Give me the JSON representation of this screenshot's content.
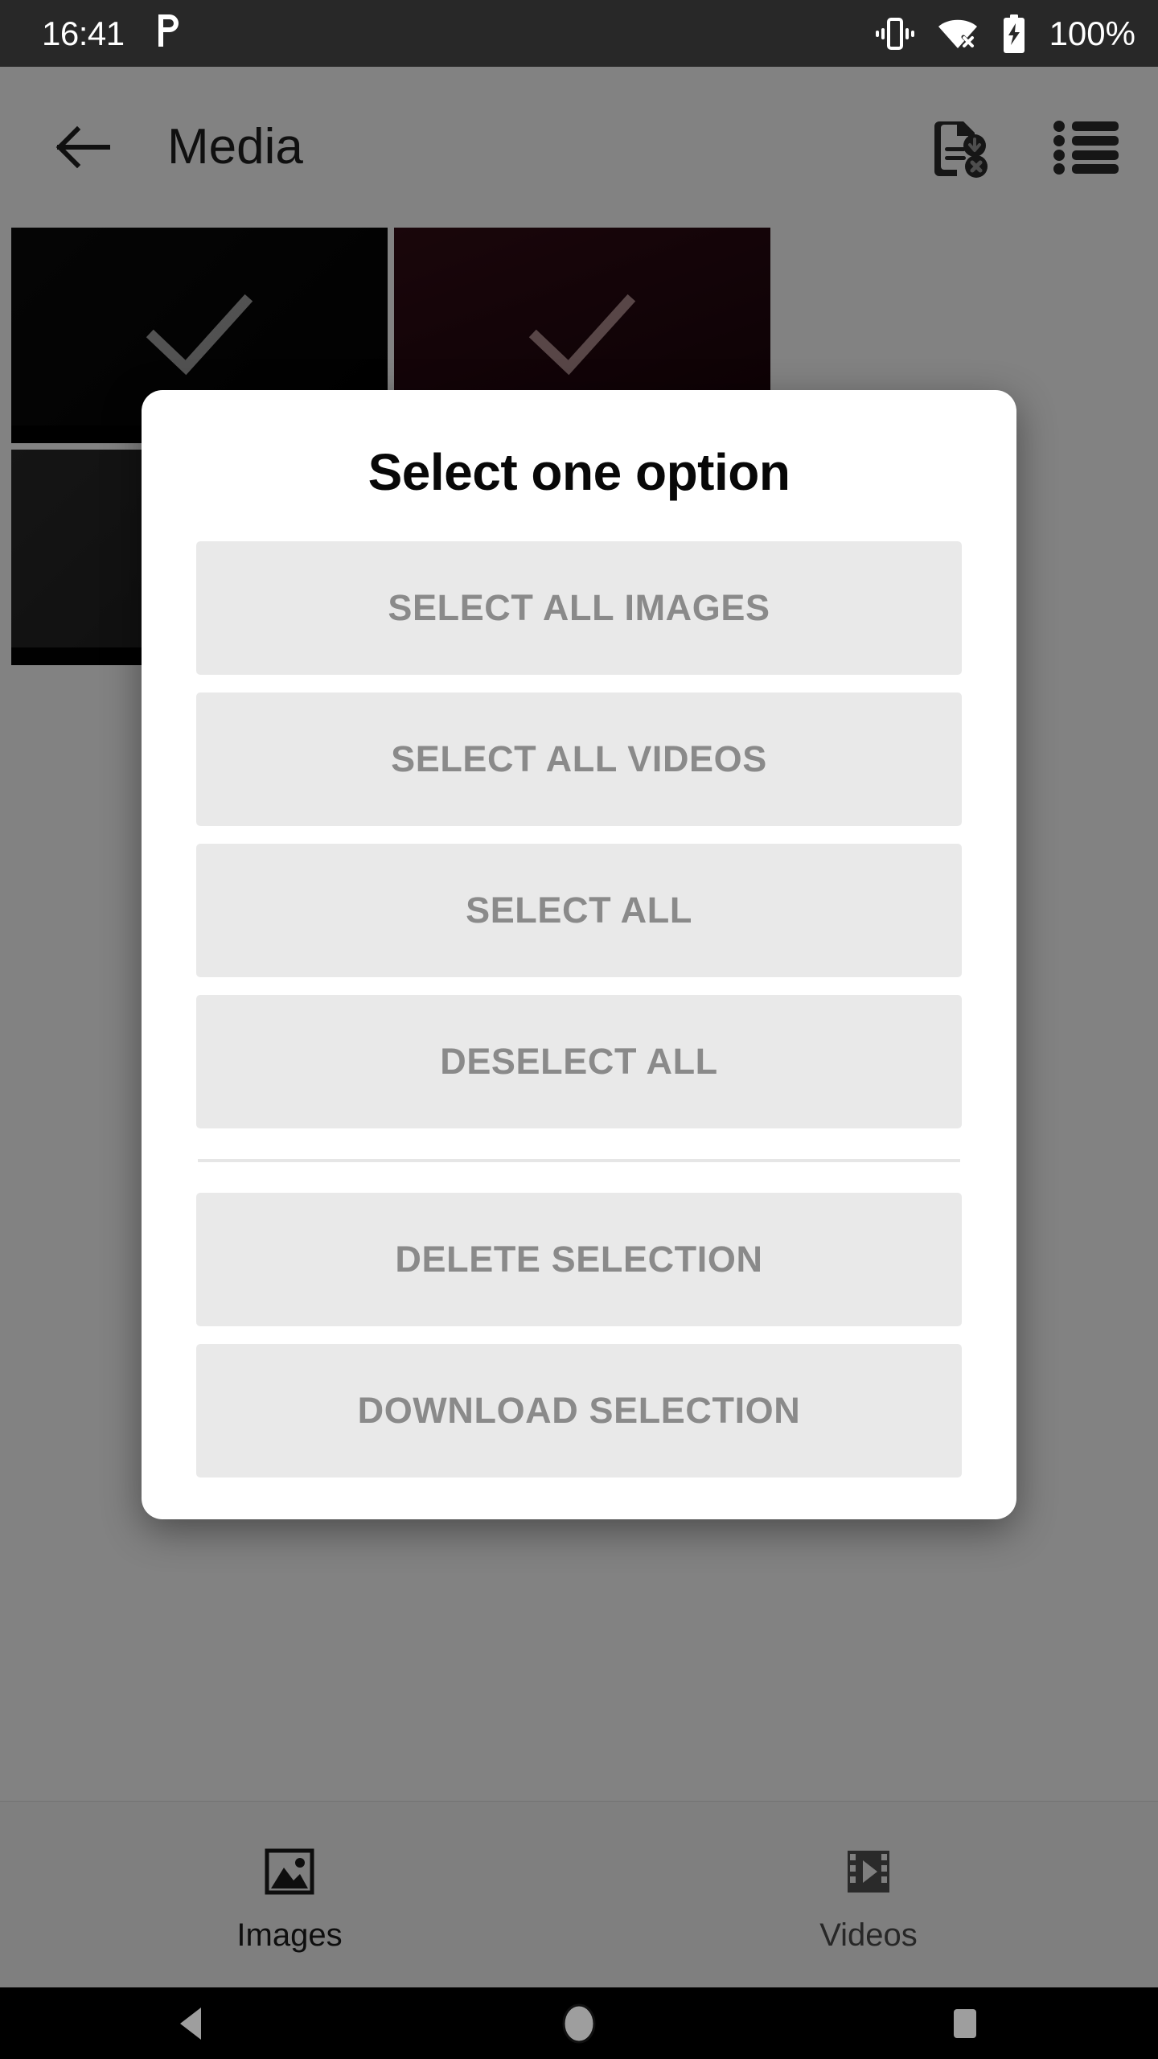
{
  "status_bar": {
    "time": "16:41",
    "notification_icon": "p-notification-icon",
    "notification_glyph": "ᴘ",
    "icons": [
      "vibrate-icon",
      "wifi-off-icon",
      "battery-charging-icon"
    ],
    "battery_percent": "100%",
    "background_color": "#282828",
    "foreground_color": "#ffffff"
  },
  "app_bar": {
    "back_icon": "back-arrow-icon",
    "title": "Media",
    "actions": [
      {
        "name": "file-download-remove-icon"
      },
      {
        "name": "list-view-icon"
      }
    ]
  },
  "media_grid": {
    "thumbnails": [
      {
        "name": "media-thumbnail-1",
        "selected": true,
        "color": "#070707",
        "check": "check-icon"
      },
      {
        "name": "media-thumbnail-2",
        "selected": true,
        "color": "#2b0a10",
        "check": "check-icon"
      },
      {
        "name": "media-thumbnail-3",
        "selected": true,
        "color": "#242424",
        "check": "check-icon"
      },
      {
        "name": "media-thumbnail-4",
        "selected": false,
        "color": "#171717",
        "check": ""
      }
    ]
  },
  "dialog": {
    "title": "Select one option",
    "buttons_group_1": [
      {
        "name": "select-all-images-button",
        "label": "SELECT ALL IMAGES"
      },
      {
        "name": "select-all-videos-button",
        "label": "SELECT ALL VIDEOS"
      },
      {
        "name": "select-all-button",
        "label": "SELECT ALL"
      },
      {
        "name": "deselect-all-button",
        "label": "DESELECT ALL"
      }
    ],
    "buttons_group_2": [
      {
        "name": "delete-selection-button",
        "label": "DELETE SELECTION"
      },
      {
        "name": "download-selection-button",
        "label": "DOWNLOAD SELECTION"
      }
    ],
    "surface_color": "#ffffff",
    "button_color": "#e9e9e9",
    "button_text_color": "#8a8a8a",
    "divider_color": "#e6e6e6"
  },
  "bottom_tabs": [
    {
      "name": "tab-images",
      "label": "Images",
      "icon": "image-icon",
      "active": true
    },
    {
      "name": "tab-videos",
      "label": "Videos",
      "icon": "film-play-icon",
      "active": false
    }
  ],
  "nav_bar": {
    "buttons": [
      {
        "name": "nav-back-button",
        "icon": "triangle-back-icon"
      },
      {
        "name": "nav-home-button",
        "icon": "circle-home-icon"
      },
      {
        "name": "nav-recents-button",
        "icon": "square-recents-icon"
      }
    ],
    "background_color": "#000000",
    "icon_color": "#9e9e9e"
  }
}
